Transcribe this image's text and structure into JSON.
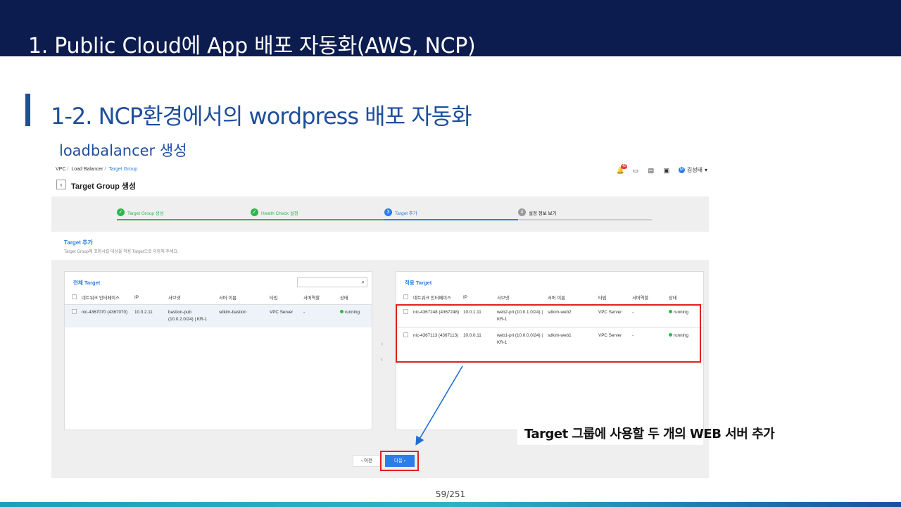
{
  "slide": {
    "title": "1. Public Cloud에 App 배포 자동화(AWS, NCP)",
    "section_title": "1-2. NCP환경에서의 wordpress 배포 자동화",
    "subtitle": "loadbalancer 생성",
    "callout": "Target 그룹에 사용할 두 개의 WEB 서버 추가",
    "page_number": "59/251"
  },
  "console": {
    "breadcrumb": [
      "VPC",
      "Load Balancer",
      "Target Group"
    ],
    "page_heading": "Target Group 생성",
    "notification_count": "40",
    "user_name": "김성태",
    "steps": [
      {
        "num": "✓",
        "label": "Target Group 생성"
      },
      {
        "num": "✓",
        "label": "Health Check 설정"
      },
      {
        "num": "3",
        "label": "Target 추가"
      },
      {
        "num": "4",
        "label": "설정 정보 보기"
      }
    ],
    "section_label": "Target 추가",
    "section_desc": "Target Group에 포함시킬 대상을 적용 Target으로 이동해 주세요.",
    "columns": [
      "네트워크 인터페이스",
      "IP",
      "서브넷",
      "서버 이름",
      "타입",
      "서버역할",
      "상태"
    ],
    "all_targets": {
      "title": "전체 Target",
      "rows": [
        {
          "nic": "nic-4367070 (4367070)",
          "ip": "10.0.2.11",
          "subnet": "bastion-pub (10.0.2.0/24) | KR-1",
          "server": "sdkim-bastion",
          "type": "VPC Server",
          "role": "-",
          "status": "running"
        }
      ]
    },
    "applied_targets": {
      "title": "적용 Target",
      "rows": [
        {
          "nic": "nic-4367248 (4367248)",
          "ip": "10.0.1.11",
          "subnet": "web2-pri (10.0.1.0/24) | KR-1",
          "server": "sdkim-web2",
          "type": "VPC Server",
          "role": "-",
          "status": "running"
        },
        {
          "nic": "nic-4367113 (4367113)",
          "ip": "10.0.0.11",
          "subnet": "web1-pri (10.0.0.0/24) | KR-1",
          "server": "sdkim-web1",
          "type": "VPC Server",
          "role": "-",
          "status": "running"
        }
      ]
    },
    "prev_button": "이전",
    "next_button": "다음"
  }
}
